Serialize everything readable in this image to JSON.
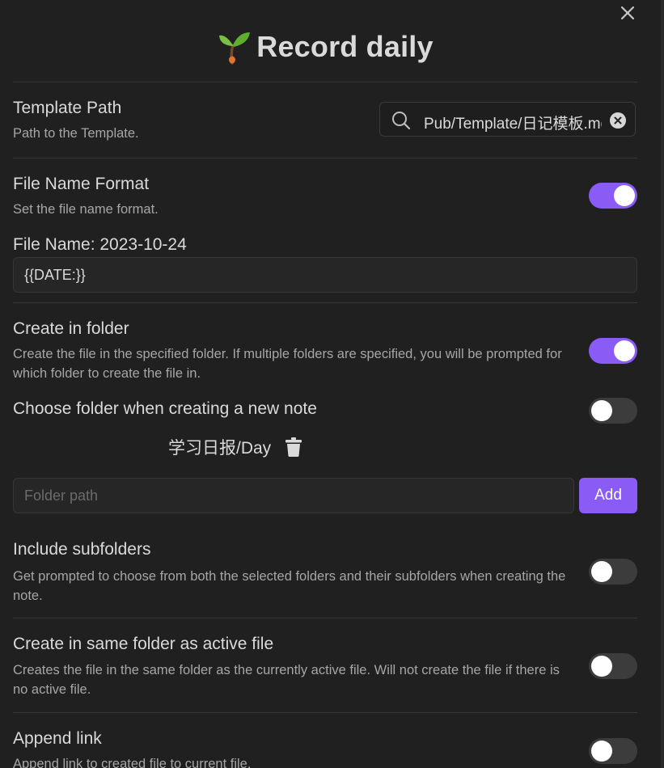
{
  "modal": {
    "title_emoji": "🌱",
    "title": "Record daily"
  },
  "settings": {
    "template_path": {
      "name": "Template Path",
      "desc": "Path to the Template.",
      "value": "Pub/Template/日记模板.md"
    },
    "file_name_format": {
      "name": "File Name Format",
      "desc": "Set the file name format.",
      "enabled": true,
      "preview": "File Name: 2023-10-24",
      "value": "{{DATE:}}"
    },
    "create_in_folder": {
      "name": "Create in folder",
      "desc": "Create the file in the specified folder. If multiple folders are specified, you will be prompted for which folder to create the file in.",
      "enabled": true
    },
    "choose_folder": {
      "name": "Choose folder when creating a new note",
      "enabled": false
    },
    "folders": {
      "items": [
        "学习日报/Day"
      ],
      "placeholder": "Folder path",
      "add_label": "Add"
    },
    "include_subfolders": {
      "name": "Include subfolders",
      "desc": "Get prompted to choose from both the selected folders and their subfolders when creating the note.",
      "enabled": false
    },
    "same_folder": {
      "name": "Create in same folder as active file",
      "desc": "Creates the file in the same folder as the currently active file. Will not create the file if there is no active file.",
      "enabled": false
    },
    "append_link": {
      "name": "Append link",
      "desc": "Append link to created file to current file.",
      "enabled": false
    }
  },
  "colors": {
    "accent": "#8a5cf5",
    "background": "#202020",
    "toggle_off": "#3c3c3c"
  }
}
